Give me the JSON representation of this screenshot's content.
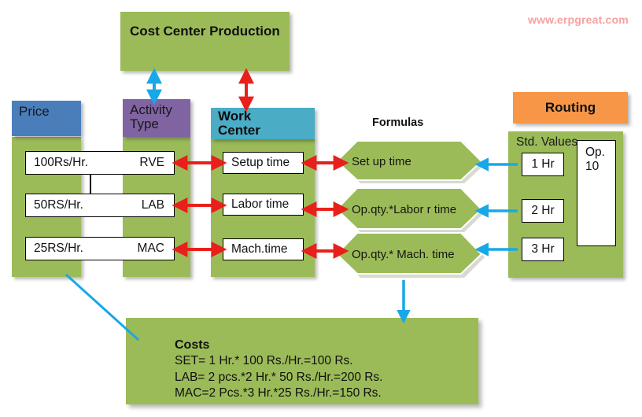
{
  "watermark": "www.erpgreat.com",
  "top": {
    "cost_center_title": "Cost Center Production"
  },
  "columns": {
    "price": {
      "header": "Price",
      "rows": [
        "100Rs/Hr.",
        "50RS/Hr.",
        "25RS/Hr."
      ]
    },
    "activity_type": {
      "header": "Activity Type",
      "header_line1": "Activity",
      "header_line2": "Type",
      "rows": [
        "RVE",
        "LAB",
        "MAC"
      ]
    },
    "work_center": {
      "header": "Work Center",
      "header_line1": "Work",
      "header_line2": "Center",
      "rows": [
        "Setup time",
        "Labor time",
        "Mach.time"
      ]
    },
    "formulas": {
      "title": "Formulas",
      "rows": [
        "Set up time",
        "Op.qty.*Labor r time",
        "Op.qty.* Mach. time"
      ]
    },
    "routing": {
      "header": "Routing",
      "std_values_label": "Std. Values",
      "rows": [
        "1 Hr",
        "2 Hr",
        "3 Hr"
      ],
      "operation": "Op. 10",
      "operation_line1": "Op.",
      "operation_line2": "10"
    }
  },
  "costs": {
    "title": "Costs",
    "lines": [
      "SET= 1 Hr.* 100 Rs./Hr.=100 Rs.",
      "LAB= 2 pcs.*2 Hr.* 50 Rs./Hr.=200 Rs.",
      "MAC=2 Pcs.*3 Hr.*25 Rs./Hr.=150 Rs."
    ]
  },
  "colors": {
    "green": "#9bbb59",
    "price_header": "#4a7ebb",
    "activity_header": "#8064a2",
    "work_center_header": "#4bacc6",
    "routing_header": "#f79646",
    "red_arrow": "#e8201b",
    "blue_arrow": "#18a8e8",
    "watermark": "#f8a0a0"
  }
}
